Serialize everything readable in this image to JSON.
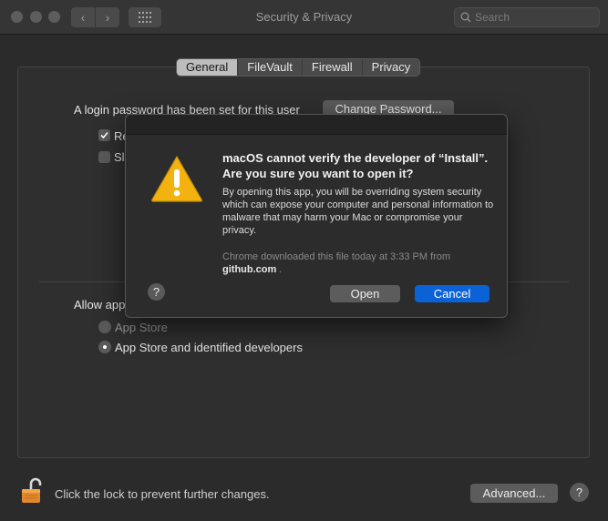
{
  "window": {
    "title": "Security & Privacy",
    "search_placeholder": "Search"
  },
  "tabs": [
    {
      "label": "General",
      "active": true
    },
    {
      "label": "FileVault",
      "active": false
    },
    {
      "label": "Firewall",
      "active": false
    },
    {
      "label": "Privacy",
      "active": false
    }
  ],
  "general": {
    "login_text": "A login password has been set for this user",
    "change_password_label": "Change Password...",
    "checkbox1_partial": "Re",
    "checkbox2_partial": "Sl",
    "allow_text": "Allow app",
    "radio_options": [
      {
        "label": "App Store",
        "selected": false
      },
      {
        "label": "App Store and identified developers",
        "selected": true
      }
    ]
  },
  "bottom": {
    "lock_text": "Click the lock to prevent further changes.",
    "advanced_label": "Advanced...",
    "help_label": "?"
  },
  "dialog": {
    "title": "macOS cannot verify the developer of “Install”. Are you sure you want to open it?",
    "body": "By opening this app, you will be overriding system security which can expose your computer and personal information to malware that may harm your Mac or compromise your privacy.",
    "note": "Chrome downloaded this file today at 3:33 PM from",
    "source": "github.com",
    "source_suffix": ".",
    "help_label": "?",
    "open_label": "Open",
    "cancel_label": "Cancel"
  },
  "colors": {
    "accent": "#0a62d6",
    "warning": "#f2b20f"
  }
}
